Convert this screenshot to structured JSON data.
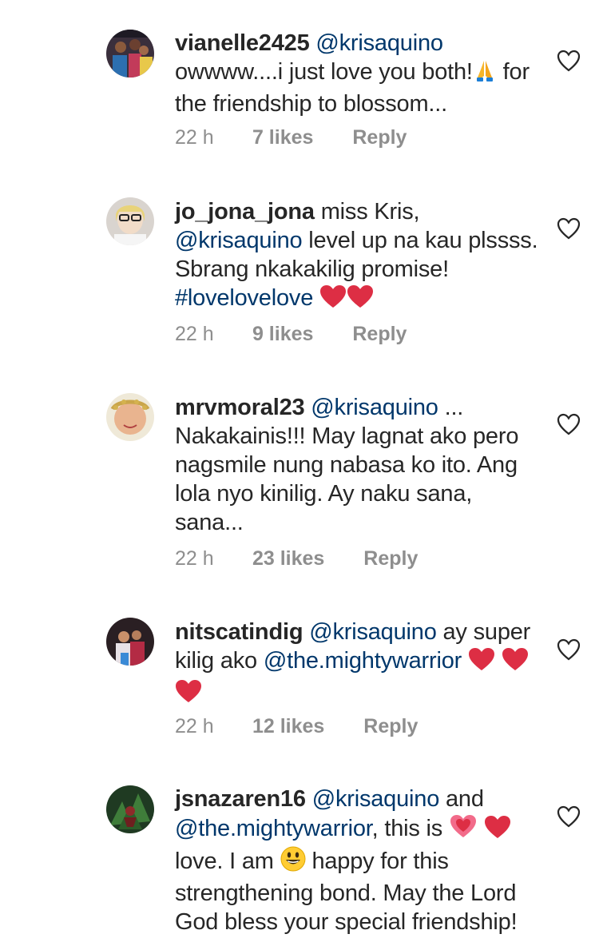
{
  "comments": [
    {
      "username": "vianelle2425",
      "text_parts": [
        "@krisaquino",
        "owwww....i just love you both!",
        "for the friendship to blossom..."
      ],
      "time": "22 h",
      "likes": "7 likes",
      "reply": "Reply"
    },
    {
      "username": "jo_jona_jona",
      "text_parts": [
        "miss Kris,",
        "@krisaquino",
        "level up na kau plssss. Sbrang nkakakilig promise!",
        "#lovelovelove"
      ],
      "time": "22 h",
      "likes": "9 likes",
      "reply": "Reply"
    },
    {
      "username": "mrvmoral23",
      "text_parts": [
        "@krisaquino",
        "...",
        "Nakakainis!!! May lagnat ako pero nagsmile nung nabasa ko ito. Ang lola nyo kinilig. Ay naku sana, sana..."
      ],
      "time": "22 h",
      "likes": "23 likes",
      "reply": "Reply"
    },
    {
      "username": "nitscatindig",
      "text_parts": [
        "@krisaquino",
        "ay super kilig ako",
        "@the.mightywarrior"
      ],
      "time": "22 h",
      "likes": "12 likes",
      "reply": "Reply"
    },
    {
      "username": "jsnazaren16",
      "text_parts": [
        "@krisaquino",
        "and",
        "@the.mightywarrior",
        ", this is",
        "love. I am",
        "happy for this strengthening bond. May the Lord God bless your special friendship!"
      ]
    }
  ],
  "colors": {
    "text": "#262626",
    "mention": "#00376b",
    "meta": "#8e8e8e",
    "heart_emoji": "#dd2e44"
  }
}
